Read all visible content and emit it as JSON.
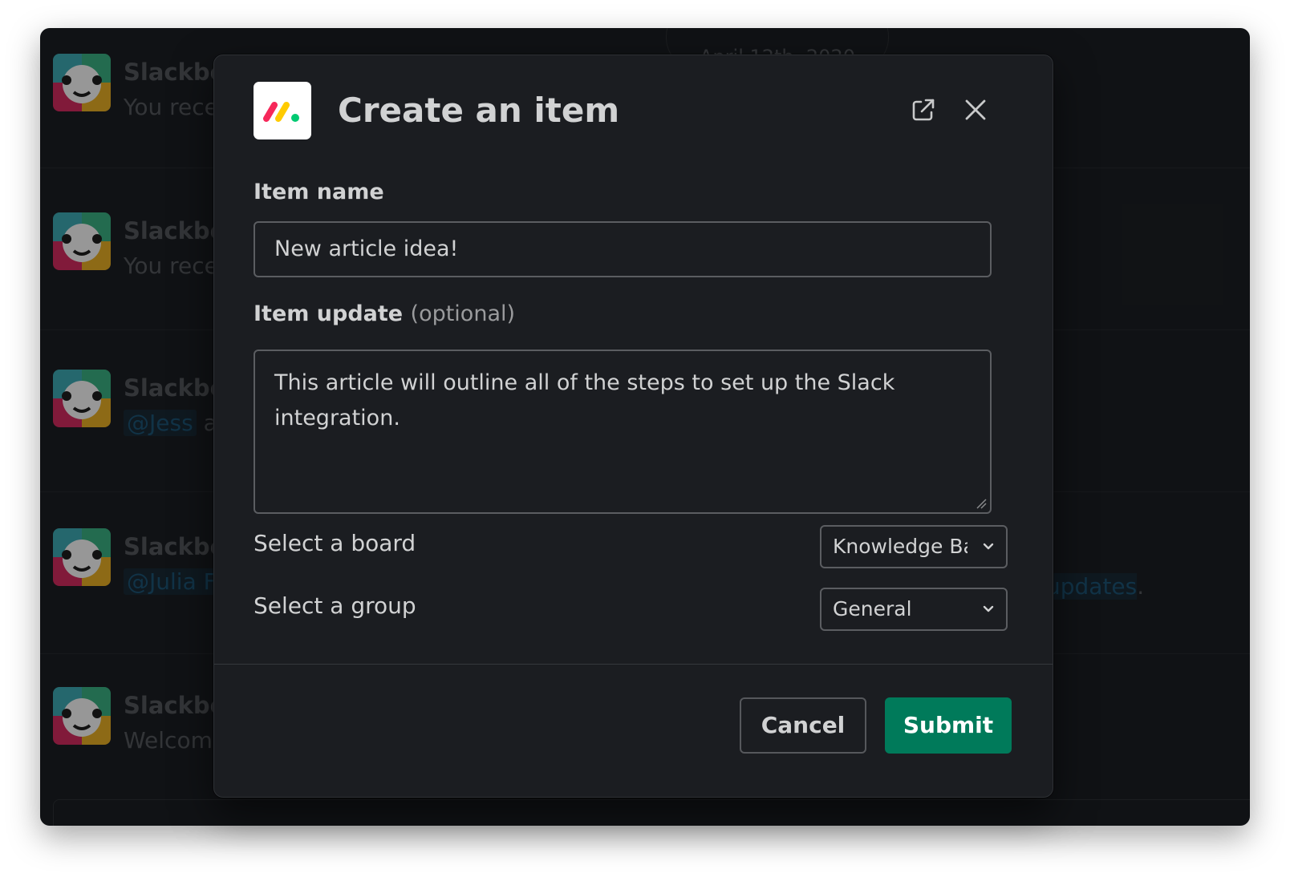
{
  "background": {
    "date_pill": "April 12th, 2020",
    "messages": [
      {
        "sender": "Slackbot",
        "preview": "You rece"
      },
      {
        "sender": "Slackbot",
        "preview": "You rece"
      },
      {
        "sender": "Slackbot",
        "mention": "@Jess",
        "preview": " ar"
      },
      {
        "sender": "Slackbot",
        "mention": "@Julia Fa",
        "preview": ""
      },
      {
        "sender": "Slackbot",
        "preview": "Welcome"
      }
    ],
    "link_text": "updates",
    "link_suffix": "."
  },
  "modal": {
    "app_icon": "monday-logo-icon",
    "title": "Create an item",
    "open_external_icon": "external-link-icon",
    "close_icon": "close-icon",
    "item_name": {
      "label": "Item name",
      "value": "New article idea!"
    },
    "item_update": {
      "label": "Item update",
      "optional": "(optional)",
      "value": "This article will outline all of the steps to set up the Slack integration."
    },
    "board": {
      "label": "Select a board",
      "value": "Knowledge Base"
    },
    "group": {
      "label": "Select a group",
      "value": "General"
    },
    "cancel_label": "Cancel",
    "submit_label": "Submit"
  },
  "colors": {
    "submit": "#007a5a",
    "background": "#1a1d21"
  }
}
